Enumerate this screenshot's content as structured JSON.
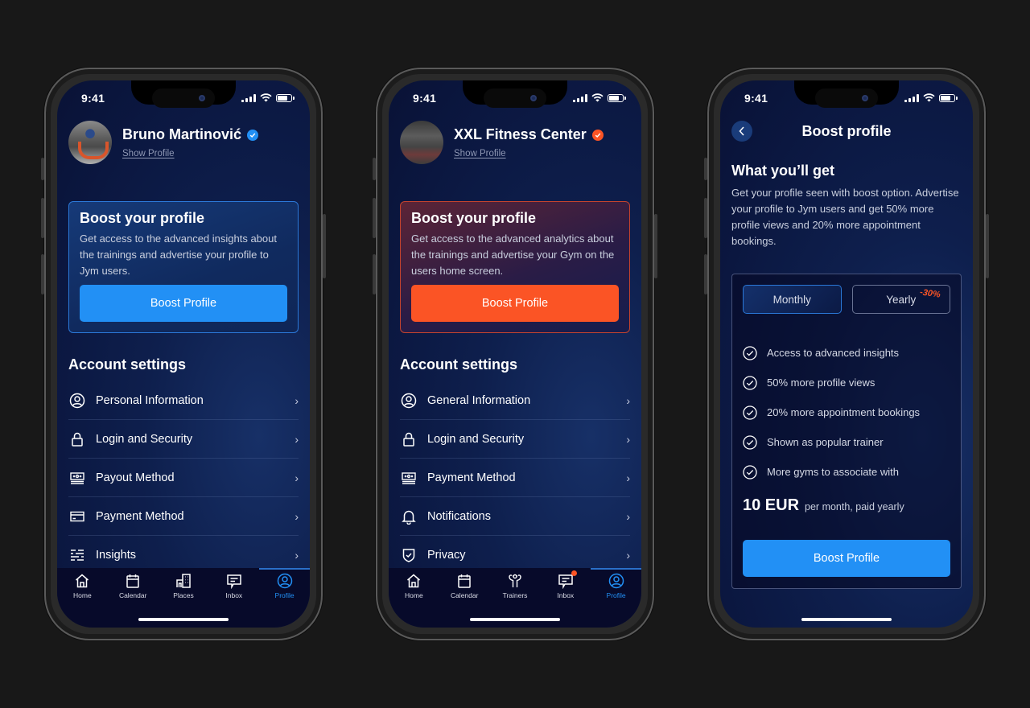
{
  "status": {
    "time": "9:41"
  },
  "colors": {
    "accent_blue": "#2290f5",
    "accent_orange": "#fb5425",
    "background": "#181818"
  },
  "screens": [
    {
      "id": "trainer-profile",
      "profile": {
        "name": "Bruno Martinović",
        "link": "Show Profile",
        "verified_badge_color": "#2290f5"
      },
      "boost": {
        "title": "Boost your profile",
        "text": "Get access to the advanced insights about the trainings and advertise your profile to Jym users.",
        "button": "Boost Profile"
      },
      "section_title": "Account settings",
      "settings": [
        {
          "icon": "user-circle-icon",
          "label": "Personal Information"
        },
        {
          "icon": "lock-icon",
          "label": "Login and Security"
        },
        {
          "icon": "cash-icon",
          "label": "Payout Method"
        },
        {
          "icon": "credit-card-icon",
          "label": "Payment Method"
        },
        {
          "icon": "insights-icon",
          "label": "Insights"
        }
      ],
      "tabs": [
        {
          "icon": "home-icon",
          "label": "Home"
        },
        {
          "icon": "calendar-icon",
          "label": "Calendar"
        },
        {
          "icon": "building-icon",
          "label": "Places"
        },
        {
          "icon": "chat-icon",
          "label": "Inbox"
        },
        {
          "icon": "profile-icon",
          "label": "Profile",
          "active": true
        }
      ]
    },
    {
      "id": "gym-profile",
      "profile": {
        "name": "XXL Fitness Center",
        "link": "Show Profile",
        "verified_badge_color": "#fb5425"
      },
      "boost": {
        "title": "Boost your profile",
        "text": "Get access to the advanced analytics about the trainings and advertise your Gym on the users home screen.",
        "button": "Boost Profile"
      },
      "section_title": "Account settings",
      "settings": [
        {
          "icon": "user-circle-icon",
          "label": "General Information"
        },
        {
          "icon": "lock-icon",
          "label": "Login and Security"
        },
        {
          "icon": "cash-icon",
          "label": "Payment Method"
        },
        {
          "icon": "bell-icon",
          "label": "Notifications"
        },
        {
          "icon": "shield-icon",
          "label": "Privacy"
        }
      ],
      "tabs": [
        {
          "icon": "home-icon",
          "label": "Home"
        },
        {
          "icon": "calendar-icon",
          "label": "Calendar"
        },
        {
          "icon": "trainers-icon",
          "label": "Trainers"
        },
        {
          "icon": "chat-icon",
          "label": "Inbox",
          "notification": true
        },
        {
          "icon": "profile-icon",
          "label": "Profile",
          "active": true
        }
      ]
    },
    {
      "id": "boost-profile",
      "title": "Boost profile",
      "section_title": "What you’ll get",
      "description": "Get your profile seen with boost option. Advertise your profile to Jym users and get 50% more profile views and 20% more appointment bookings.",
      "plans": [
        {
          "label": "Monthly",
          "selected": true
        },
        {
          "label": "Yearly",
          "discount": "-30%",
          "selected": false
        }
      ],
      "features": [
        "Access to advanced insights",
        "50% more profile views",
        "20% more appointment bookings",
        "Shown as popular trainer",
        "More gyms to associate with"
      ],
      "price": {
        "amount": "10 EUR",
        "period": "per month, paid yearly"
      },
      "button": "Boost Profile"
    }
  ]
}
